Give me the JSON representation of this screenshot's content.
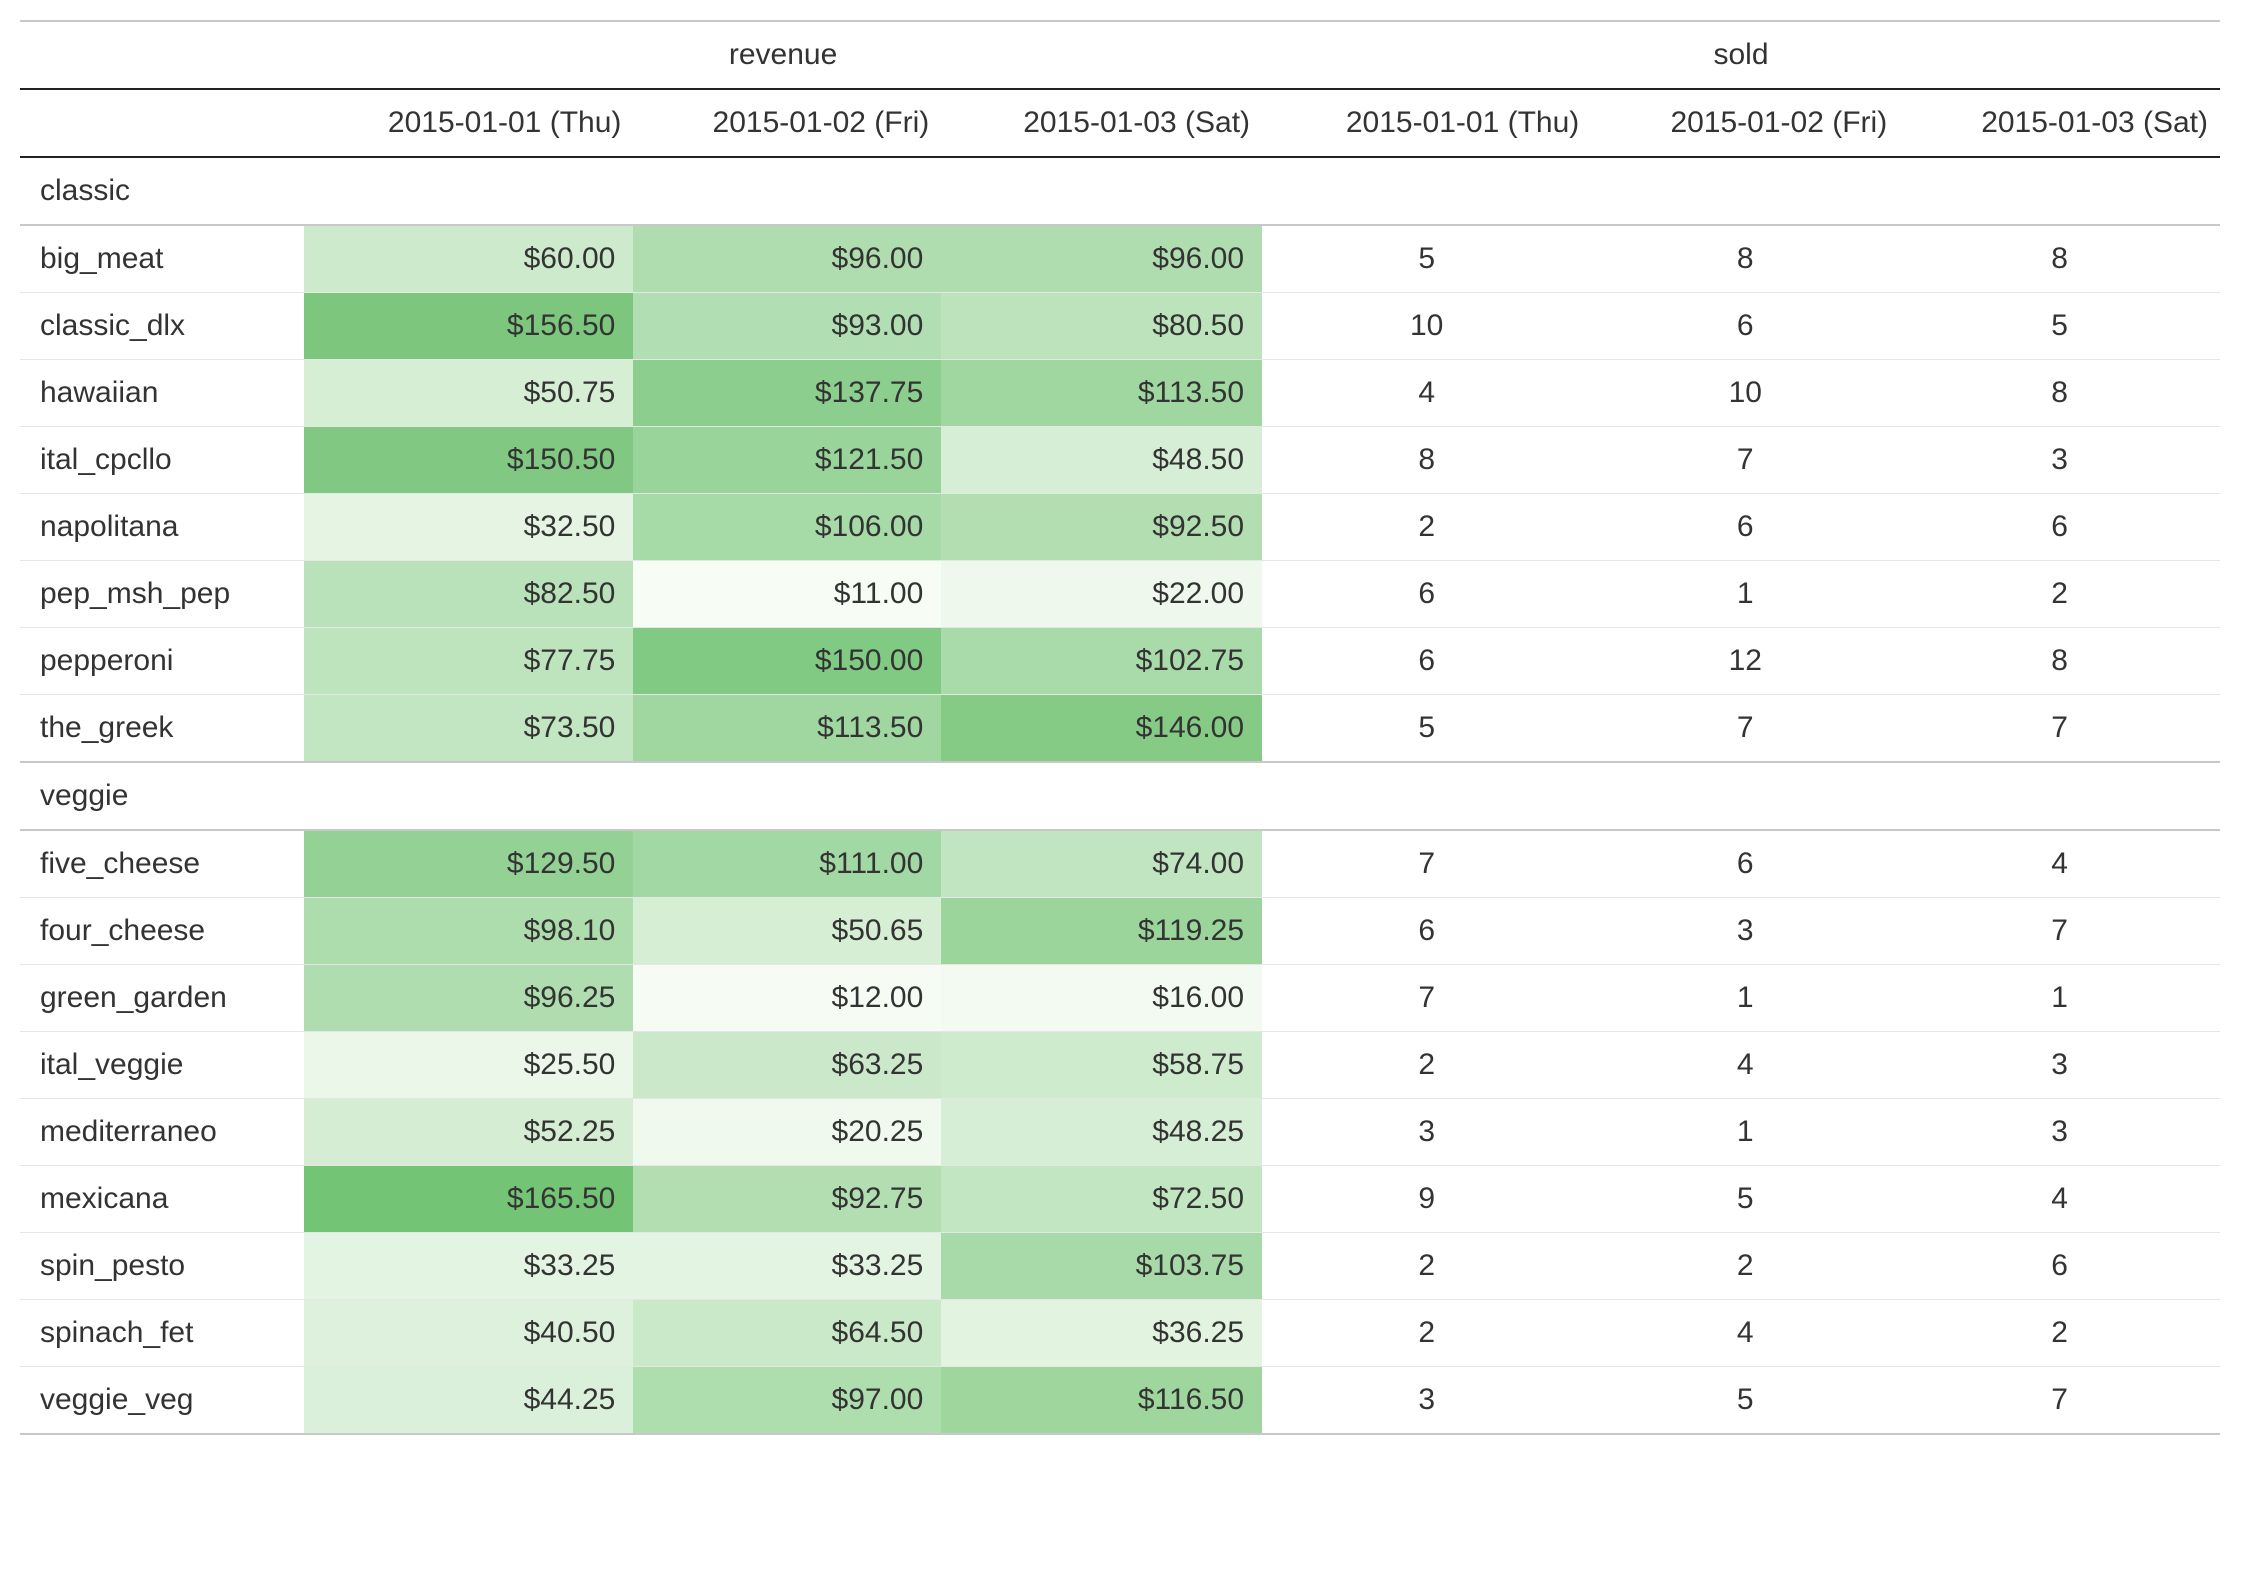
{
  "columns": {
    "top": [
      "revenue",
      "sold"
    ],
    "dates": [
      "2015-01-01 (Thu)",
      "2015-01-02 (Fri)",
      "2015-01-03 (Sat)"
    ]
  },
  "groups": [
    {
      "name": "classic",
      "rows": [
        {
          "name": "big_meat",
          "revenue": [
            "$60.00",
            "$96.00",
            "$96.00"
          ],
          "sold": [
            5,
            8,
            8
          ]
        },
        {
          "name": "classic_dlx",
          "revenue": [
            "$156.50",
            "$93.00",
            "$80.50"
          ],
          "sold": [
            10,
            6,
            5
          ]
        },
        {
          "name": "hawaiian",
          "revenue": [
            "$50.75",
            "$137.75",
            "$113.50"
          ],
          "sold": [
            4,
            10,
            8
          ]
        },
        {
          "name": "ital_cpcllo",
          "revenue": [
            "$150.50",
            "$121.50",
            "$48.50"
          ],
          "sold": [
            8,
            7,
            3
          ]
        },
        {
          "name": "napolitana",
          "revenue": [
            "$32.50",
            "$106.00",
            "$92.50"
          ],
          "sold": [
            2,
            6,
            6
          ]
        },
        {
          "name": "pep_msh_pep",
          "revenue": [
            "$82.50",
            "$11.00",
            "$22.00"
          ],
          "sold": [
            6,
            1,
            2
          ]
        },
        {
          "name": "pepperoni",
          "revenue": [
            "$77.75",
            "$150.00",
            "$102.75"
          ],
          "sold": [
            6,
            12,
            8
          ]
        },
        {
          "name": "the_greek",
          "revenue": [
            "$73.50",
            "$113.50",
            "$146.00"
          ],
          "sold": [
            5,
            7,
            7
          ]
        }
      ]
    },
    {
      "name": "veggie",
      "rows": [
        {
          "name": "five_cheese",
          "revenue": [
            "$129.50",
            "$111.00",
            "$74.00"
          ],
          "sold": [
            7,
            6,
            4
          ]
        },
        {
          "name": "four_cheese",
          "revenue": [
            "$98.10",
            "$50.65",
            "$119.25"
          ],
          "sold": [
            6,
            3,
            7
          ]
        },
        {
          "name": "green_garden",
          "revenue": [
            "$96.25",
            "$12.00",
            "$16.00"
          ],
          "sold": [
            7,
            1,
            1
          ]
        },
        {
          "name": "ital_veggie",
          "revenue": [
            "$25.50",
            "$63.25",
            "$58.75"
          ],
          "sold": [
            2,
            4,
            3
          ]
        },
        {
          "name": "mediterraneo",
          "revenue": [
            "$52.25",
            "$20.25",
            "$48.25"
          ],
          "sold": [
            3,
            1,
            3
          ]
        },
        {
          "name": "mexicana",
          "revenue": [
            "$165.50",
            "$92.75",
            "$72.50"
          ],
          "sold": [
            9,
            5,
            4
          ]
        },
        {
          "name": "spin_pesto",
          "revenue": [
            "$33.25",
            "$33.25",
            "$103.75"
          ],
          "sold": [
            2,
            2,
            6
          ]
        },
        {
          "name": "spinach_fet",
          "revenue": [
            "$40.50",
            "$64.50",
            "$36.25"
          ],
          "sold": [
            2,
            4,
            2
          ]
        },
        {
          "name": "veggie_veg",
          "revenue": [
            "$44.25",
            "$97.00",
            "$116.50"
          ],
          "sold": [
            3,
            5,
            7
          ]
        }
      ]
    }
  ],
  "chart_data": {
    "type": "table",
    "title": "",
    "heatmap_metric": "revenue",
    "color_scale": "Greens",
    "color_domain": [
      11.0,
      165.5
    ],
    "categories": [
      "2015-01-01 (Thu)",
      "2015-01-02 (Fri)",
      "2015-01-03 (Sat)"
    ],
    "series": [
      {
        "group": "classic",
        "name": "big_meat",
        "revenue": [
          60.0,
          96.0,
          96.0
        ],
        "sold": [
          5,
          8,
          8
        ]
      },
      {
        "group": "classic",
        "name": "classic_dlx",
        "revenue": [
          156.5,
          93.0,
          80.5
        ],
        "sold": [
          10,
          6,
          5
        ]
      },
      {
        "group": "classic",
        "name": "hawaiian",
        "revenue": [
          50.75,
          137.75,
          113.5
        ],
        "sold": [
          4,
          10,
          8
        ]
      },
      {
        "group": "classic",
        "name": "ital_cpcllo",
        "revenue": [
          150.5,
          121.5,
          48.5
        ],
        "sold": [
          8,
          7,
          3
        ]
      },
      {
        "group": "classic",
        "name": "napolitana",
        "revenue": [
          32.5,
          106.0,
          92.5
        ],
        "sold": [
          2,
          6,
          6
        ]
      },
      {
        "group": "classic",
        "name": "pep_msh_pep",
        "revenue": [
          82.5,
          11.0,
          22.0
        ],
        "sold": [
          6,
          1,
          2
        ]
      },
      {
        "group": "classic",
        "name": "pepperoni",
        "revenue": [
          77.75,
          150.0,
          102.75
        ],
        "sold": [
          6,
          12,
          8
        ]
      },
      {
        "group": "classic",
        "name": "the_greek",
        "revenue": [
          73.5,
          113.5,
          146.0
        ],
        "sold": [
          5,
          7,
          7
        ]
      },
      {
        "group": "veggie",
        "name": "five_cheese",
        "revenue": [
          129.5,
          111.0,
          74.0
        ],
        "sold": [
          7,
          6,
          4
        ]
      },
      {
        "group": "veggie",
        "name": "four_cheese",
        "revenue": [
          98.1,
          50.65,
          119.25
        ],
        "sold": [
          6,
          3,
          7
        ]
      },
      {
        "group": "veggie",
        "name": "green_garden",
        "revenue": [
          96.25,
          12.0,
          16.0
        ],
        "sold": [
          7,
          1,
          1
        ]
      },
      {
        "group": "veggie",
        "name": "ital_veggie",
        "revenue": [
          25.5,
          63.25,
          58.75
        ],
        "sold": [
          2,
          4,
          3
        ]
      },
      {
        "group": "veggie",
        "name": "mediterraneo",
        "revenue": [
          52.25,
          20.25,
          48.25
        ],
        "sold": [
          3,
          1,
          3
        ]
      },
      {
        "group": "veggie",
        "name": "mexicana",
        "revenue": [
          165.5,
          92.75,
          72.5
        ],
        "sold": [
          9,
          5,
          4
        ]
      },
      {
        "group": "veggie",
        "name": "spin_pesto",
        "revenue": [
          33.25,
          33.25,
          103.75
        ],
        "sold": [
          2,
          2,
          6
        ]
      },
      {
        "group": "veggie",
        "name": "spinach_fet",
        "revenue": [
          40.5,
          64.5,
          36.25
        ],
        "sold": [
          2,
          4,
          2
        ]
      },
      {
        "group": "veggie",
        "name": "veggie_veg",
        "revenue": [
          44.25,
          97.0,
          116.5
        ],
        "sold": [
          3,
          5,
          7
        ]
      }
    ]
  }
}
